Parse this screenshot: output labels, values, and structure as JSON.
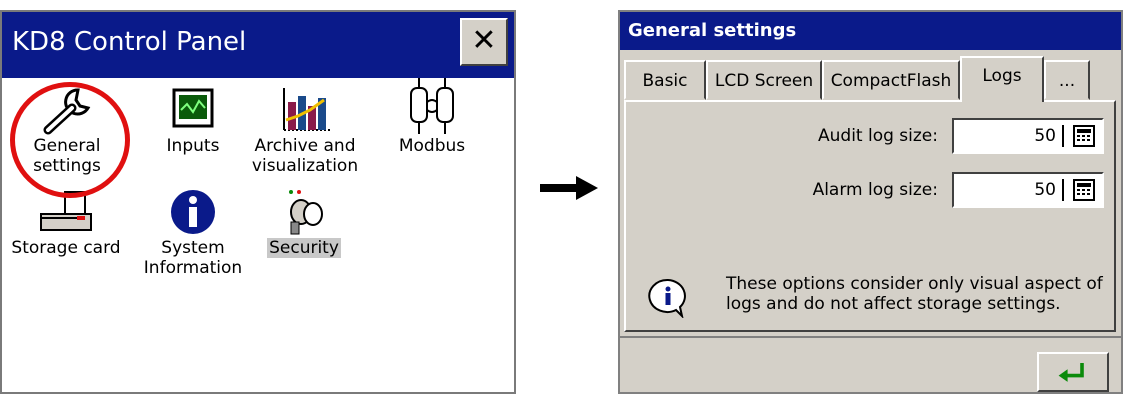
{
  "control_panel": {
    "title": "KD8 Control Panel",
    "close_glyph": "✕",
    "items": [
      {
        "label": "General settings",
        "icon": "wrench-icon",
        "selected": false
      },
      {
        "label": "Inputs",
        "icon": "monitor-signal-icon",
        "selected": false
      },
      {
        "label": "Archive and visualization",
        "icon": "bar-chart-icon",
        "selected": false
      },
      {
        "label": "Modbus",
        "icon": "network-plug-icon",
        "selected": false
      },
      {
        "label": "Storage card",
        "icon": "storage-card-icon",
        "selected": false
      },
      {
        "label": "System Information",
        "icon": "info-icon",
        "selected": false
      },
      {
        "label": "Security",
        "icon": "keys-icon",
        "selected": true
      }
    ],
    "highlight_color": "#e01010"
  },
  "general_settings": {
    "title": "General settings",
    "tabs": [
      {
        "label": "Basic",
        "active": false
      },
      {
        "label": "LCD Screen",
        "active": false
      },
      {
        "label": "CompactFlash",
        "active": false
      },
      {
        "label": "Logs",
        "active": true
      },
      {
        "label": "...",
        "active": false
      }
    ],
    "fields": [
      {
        "label": "Audit log size:",
        "value": "50"
      },
      {
        "label": "Alarm log size:",
        "value": "50"
      }
    ],
    "info_text": "These options consider only visual aspect of logs and do not affect storage settings.",
    "ok_button_glyph": "↵",
    "ok_color": "#0a8a0a"
  },
  "colors": {
    "titlebar": "#0a1a8a",
    "window_face": "#d4d0c8"
  }
}
